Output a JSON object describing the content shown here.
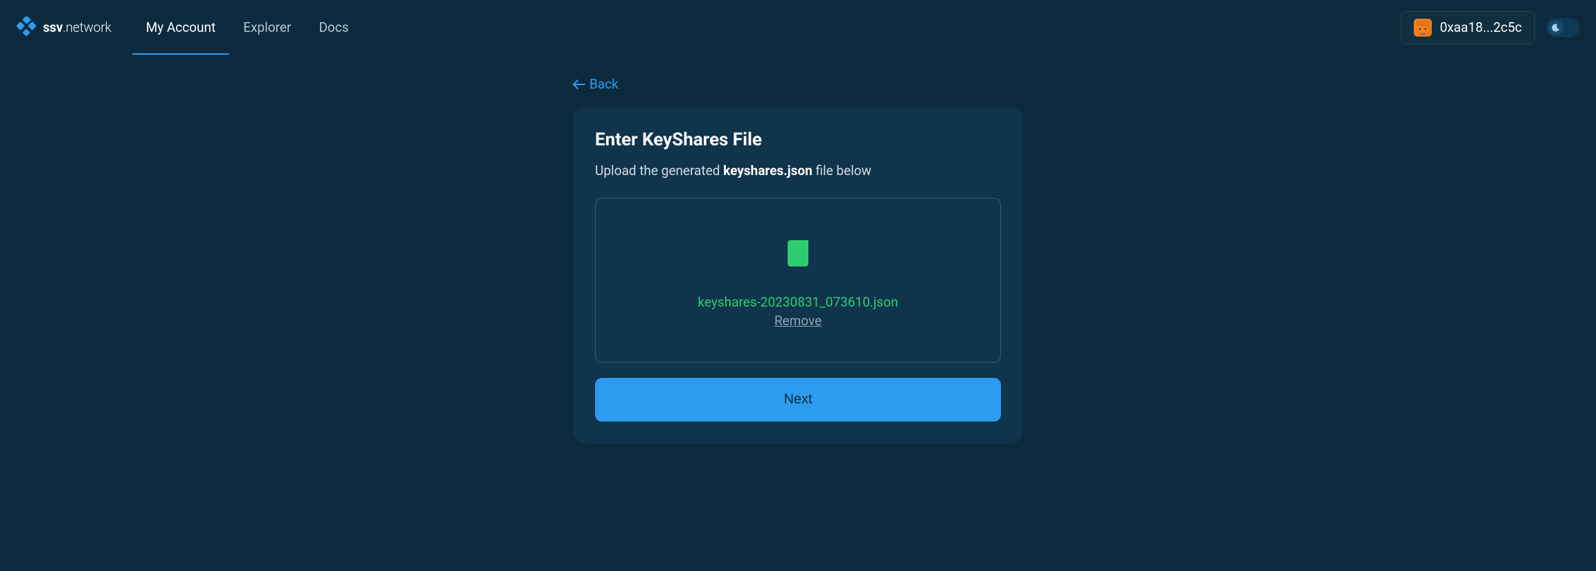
{
  "header": {
    "logo_bold": "ssv",
    "logo_light": ".network",
    "nav": {
      "my_account": "My Account",
      "explorer": "Explorer",
      "docs": "Docs"
    },
    "wallet_address": "0xaa18...2c5c"
  },
  "back": {
    "label": "Back"
  },
  "card": {
    "title": "Enter KeyShares File",
    "desc_prefix": "Upload the generated ",
    "desc_bold": "keyshares.json",
    "desc_suffix": " file below",
    "file_name": "keyshares-20230831_073610.json",
    "remove_label": "Remove",
    "next_label": "Next"
  }
}
